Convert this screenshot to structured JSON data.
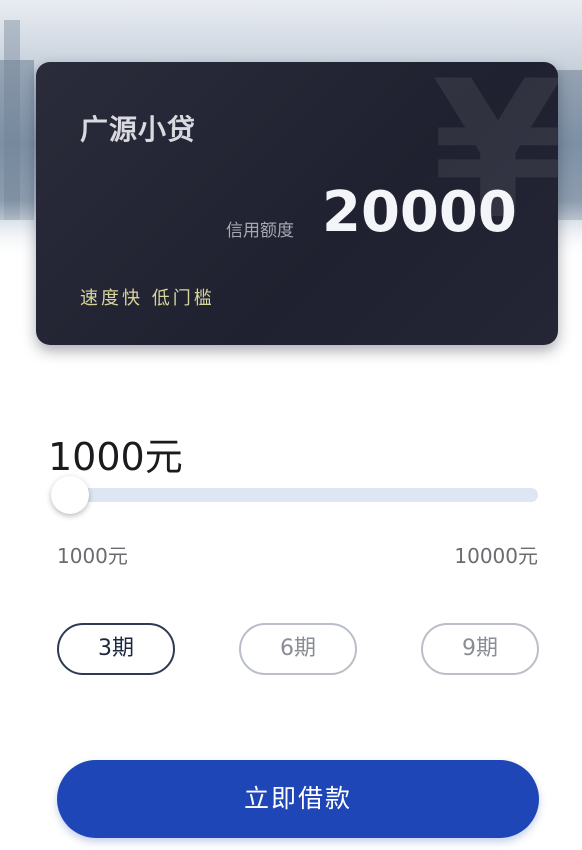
{
  "card": {
    "brand": "广源小贷",
    "credit_label": "信用额度",
    "credit_amount": "20000",
    "tagline": "速度快 低门槛",
    "watermark_icon": "yuan-icon"
  },
  "loan": {
    "selected_amount": "1000元",
    "min_label": "1000元",
    "max_label": "10000元",
    "slider_min": 1000,
    "slider_max": 10000,
    "slider_value": 1000
  },
  "terms": [
    {
      "label": "3期",
      "selected": true
    },
    {
      "label": "6期",
      "selected": false
    },
    {
      "label": "9期",
      "selected": false
    }
  ],
  "actions": {
    "borrow_label": "立即借款"
  },
  "colors": {
    "card_bg": "#232535",
    "accent_blue": "#1f46b7",
    "tagline": "#d7d69a",
    "track": "#dee5f3"
  }
}
